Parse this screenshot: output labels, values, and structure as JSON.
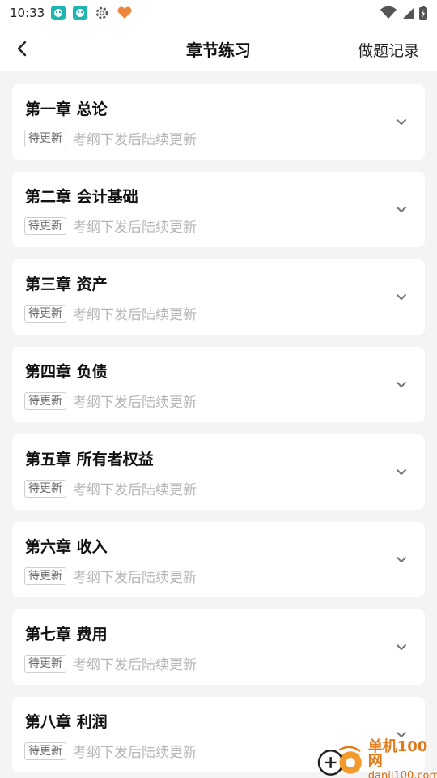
{
  "status_bar": {
    "time": "10:33"
  },
  "header": {
    "title": "章节练习",
    "record_label": "做题记录"
  },
  "chapters": [
    {
      "title": "第一章 总论",
      "tag": "待更新",
      "note": "考纲下发后陆续更新"
    },
    {
      "title": "第二章 会计基础",
      "tag": "待更新",
      "note": "考纲下发后陆续更新"
    },
    {
      "title": "第三章 资产",
      "tag": "待更新",
      "note": "考纲下发后陆续更新"
    },
    {
      "title": "第四章 负债",
      "tag": "待更新",
      "note": "考纲下发后陆续更新"
    },
    {
      "title": "第五章 所有者权益",
      "tag": "待更新",
      "note": "考纲下发后陆续更新"
    },
    {
      "title": "第六章 收入",
      "tag": "待更新",
      "note": "考纲下发后陆续更新"
    },
    {
      "title": "第七章 费用",
      "tag": "待更新",
      "note": "考纲下发后陆续更新"
    },
    {
      "title": "第八章 利润",
      "tag": "待更新",
      "note": "考纲下发后陆续更新"
    }
  ],
  "watermark": {
    "name": "单机100网",
    "url": "danji100.com"
  },
  "icons": {
    "back": "back-arrow-icon",
    "expand": "chevron-down-icon",
    "wifi": "wifi-icon",
    "signal": "signal-icon",
    "battery": "battery-icon"
  },
  "colors": {
    "accent": "#e07a1c",
    "teal_app": "#1fb5b0"
  }
}
